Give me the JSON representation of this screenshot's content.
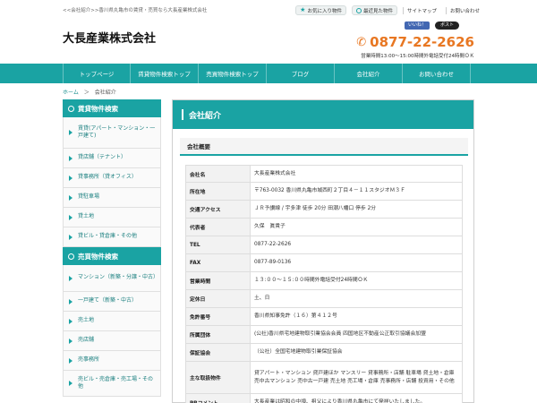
{
  "header": {
    "tagline": "<<会社紹介>>香川県丸亀市の賃貸・売買なら大長産業株式会社",
    "favorites_label": "お気に入り物件",
    "recent_label": "最近見た物件",
    "sitemap_label": "サイトマップ",
    "contact_label": "お問い合わせ",
    "logo": "大長産業株式会社",
    "fb_label": "いいね！",
    "x_label": "ポスト",
    "phone": "0877-22-2626",
    "hours": "営業時間13:00～15:00時間外電話受付24時間ＯＫ"
  },
  "nav": [
    {
      "label": "トップページ"
    },
    {
      "label": "賃貸物件検索トップ"
    },
    {
      "label": "売買物件検索トップ"
    },
    {
      "label": "ブログ"
    },
    {
      "label": "会社紹介"
    },
    {
      "label": "お問い合わせ"
    }
  ],
  "breadcrumb": {
    "home": "ホーム",
    "sep": "＞",
    "current": "会社紹介"
  },
  "sidebar": {
    "rent_title": "賃貸物件検索",
    "rent_items": [
      {
        "label": "賃貸(アパート・マンション・一戸建て)"
      },
      {
        "label": "貸店舗（テナント）"
      },
      {
        "label": "貸事務所（貸オフィス）"
      },
      {
        "label": "貸駐車場"
      },
      {
        "label": "貸土地"
      },
      {
        "label": "貸ビル・貸倉庫・その他"
      }
    ],
    "sale_title": "売買物件検索",
    "sale_items": [
      {
        "label": "マンション（新築・分譲・中古）"
      },
      {
        "label": "一戸建て（新築・中古）"
      },
      {
        "label": "売土地"
      },
      {
        "label": "売店舗"
      },
      {
        "label": "売事務所"
      },
      {
        "label": "売ビル・売倉庫・売工場・その他"
      }
    ]
  },
  "content": {
    "title": "会社紹介",
    "section": "会社概要",
    "rows": [
      {
        "key": "会社名",
        "value": "大長産業株式会社"
      },
      {
        "key": "所在地",
        "value": "〒763-0032 香川県丸亀市城西町２丁目４－１１スタジオＭ３Ｆ"
      },
      {
        "key": "交通アクセス",
        "value": "ＪＲ予讃線 / 宇多津 徒歩 20分 田潮八幡口 停歩 2分"
      },
      {
        "key": "代表者",
        "value": "久保　眞貴子"
      },
      {
        "key": "TEL",
        "value": "0877-22-2626"
      },
      {
        "key": "FAX",
        "value": "0877-89-0136"
      },
      {
        "key": "営業時間",
        "value": "１３:００～１５:００時間外電話受付24時間ＯＫ"
      },
      {
        "key": "定休日",
        "value": "土、日"
      },
      {
        "key": "免許番号",
        "value": "香川県知事免許（１６）第４１２号"
      },
      {
        "key": "所属団体",
        "value": "(公社)香川県宅地建物取引業協会会員 四国地区不動産公正取引協議会加盟"
      },
      {
        "key": "保証協会",
        "value": "（公社）全国宅地建物取引業保証協会"
      },
      {
        "key": "主な取扱物件",
        "value": "貸アパート・マンション 貸戸建ほか マンスリー 貸事務所・店舗 駐車場 貸土地・倉庫 売中古マンション 売中古一戸建 売土地 売工場・倉庫 売事務所・店舗 投資用・その他"
      },
      {
        "key": "PRコメント",
        "value": "大長産業は昭和の中頃、祖父により香川県丸亀市にて発祥いたしました。"
      }
    ]
  }
}
